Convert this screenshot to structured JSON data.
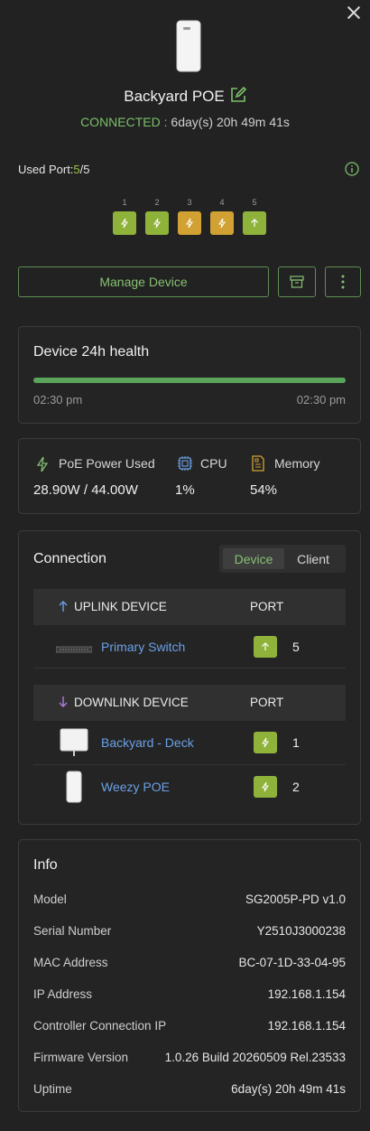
{
  "colors": {
    "background": "#222222",
    "accent_green": "#86c072",
    "port_green": "#8fb33a",
    "port_amber": "#d1a233",
    "link_blue": "#6aa0e6"
  },
  "header": {
    "device_name": "Backyard POE",
    "status_label": "CONNECTED",
    "status_separator": " : ",
    "uptime": "6day(s) 20h 49m 41s"
  },
  "ports": {
    "used_label": "Used Port:",
    "used_count": "5",
    "total_count": "/5",
    "items": [
      {
        "num": "1",
        "color": "green",
        "icon": "bolt-icon"
      },
      {
        "num": "2",
        "color": "green",
        "icon": "bolt-icon"
      },
      {
        "num": "3",
        "color": "amber",
        "icon": "bolt-icon"
      },
      {
        "num": "4",
        "color": "amber",
        "icon": "bolt-icon"
      },
      {
        "num": "5",
        "color": "green",
        "icon": "arrow-up-icon"
      }
    ]
  },
  "actions": {
    "manage_label": "Manage Device"
  },
  "health": {
    "title": "Device 24h health",
    "start_time": "02:30 pm",
    "end_time": "02:30 pm",
    "bar_fill_pct": 100
  },
  "stats": [
    {
      "label": "PoE Power Used",
      "value": "28.90W / 44.00W",
      "icon": "bolt-icon"
    },
    {
      "label": "CPU",
      "value": "1%",
      "icon": "cpu-icon"
    },
    {
      "label": "Memory",
      "value": "54%",
      "icon": "memory-icon"
    }
  ],
  "connection": {
    "title": "Connection",
    "tabs": [
      "Device",
      "Client"
    ],
    "active_tab": "Device",
    "uplink_header": "UPLINK DEVICE",
    "downlink_header": "DOWNLINK DEVICE",
    "port_header": "PORT",
    "uplink": [
      {
        "name": "Primary Switch",
        "port": "5",
        "icon": "arrow-up-icon"
      }
    ],
    "downlink": [
      {
        "name": "Backyard - Deck",
        "port": "1",
        "icon": "bolt-icon"
      },
      {
        "name": "Weezy POE",
        "port": "2",
        "icon": "bolt-icon"
      }
    ]
  },
  "info": {
    "title": "Info",
    "rows": [
      {
        "label": "Model",
        "value": "SG2005P-PD v1.0"
      },
      {
        "label": "Serial Number",
        "value": "Y2510J3000238"
      },
      {
        "label": "MAC Address",
        "value": "BC-07-1D-33-04-95"
      },
      {
        "label": "IP Address",
        "value": "192.168.1.154"
      },
      {
        "label": "Controller Connection IP",
        "value": "192.168.1.154"
      },
      {
        "label": "Firmware Version",
        "value": "1.0.26 Build 20260509 Rel.23533"
      },
      {
        "label": "Uptime",
        "value": "6day(s) 20h 49m 41s"
      }
    ]
  }
}
